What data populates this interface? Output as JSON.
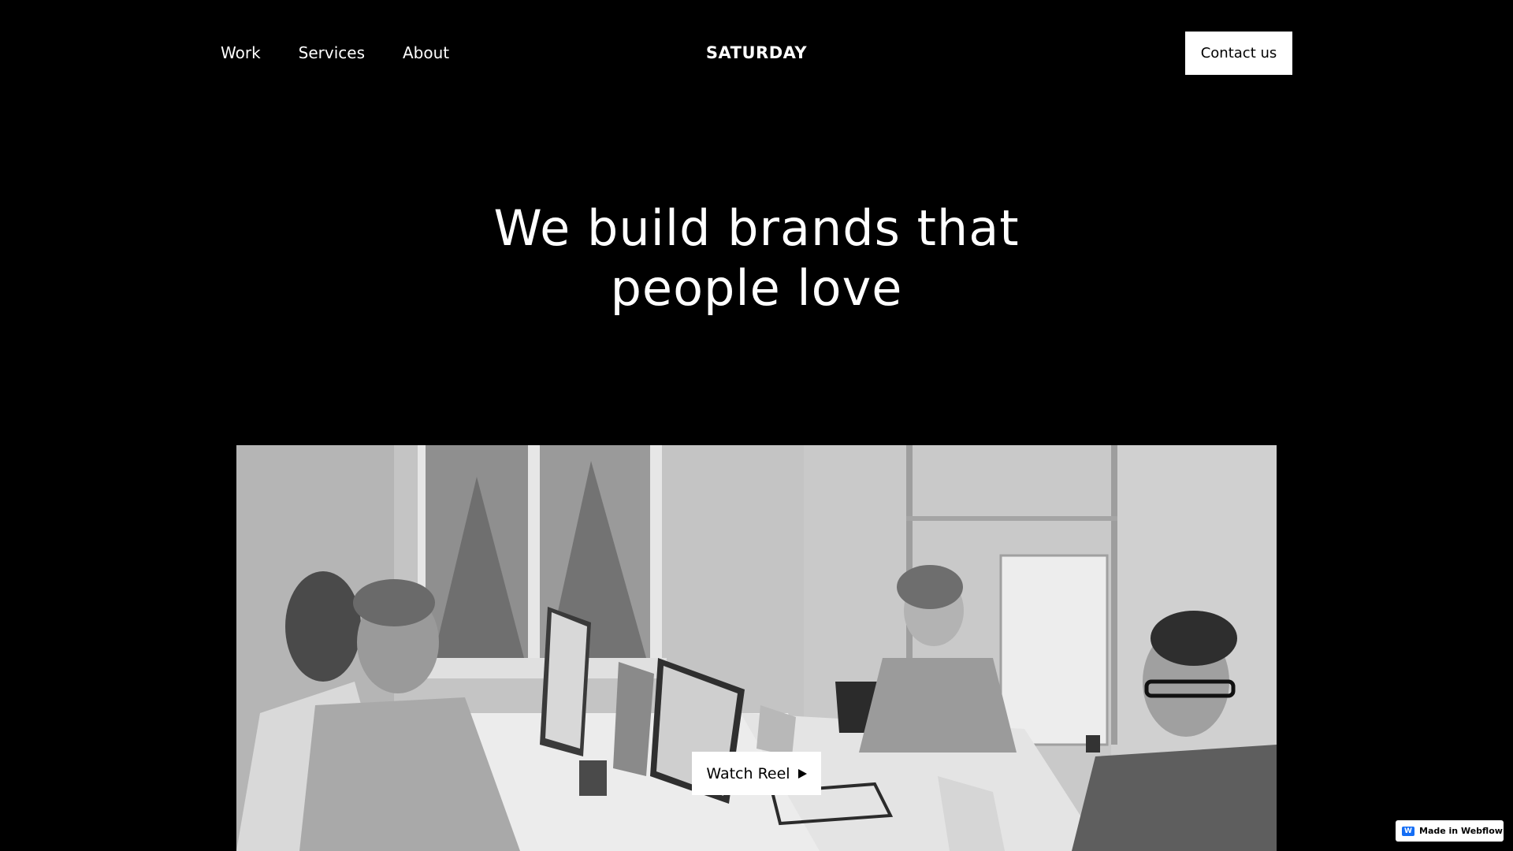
{
  "nav": {
    "links": [
      "Work",
      "Services",
      "About"
    ],
    "logo": "SATURDAY",
    "contact_label": "Contact us"
  },
  "hero": {
    "title_line1": "We build brands that",
    "title_line2": "people love"
  },
  "media": {
    "watch_label": "Watch Reel",
    "play_icon": "play-icon"
  },
  "badge": {
    "label": "Made in Webflow",
    "icon": "webflow-logo-icon"
  },
  "colors": {
    "background": "#000000",
    "text": "#ffffff",
    "button_bg": "#ffffff",
    "button_text": "#000000",
    "webflow_blue": "#146ef5"
  }
}
